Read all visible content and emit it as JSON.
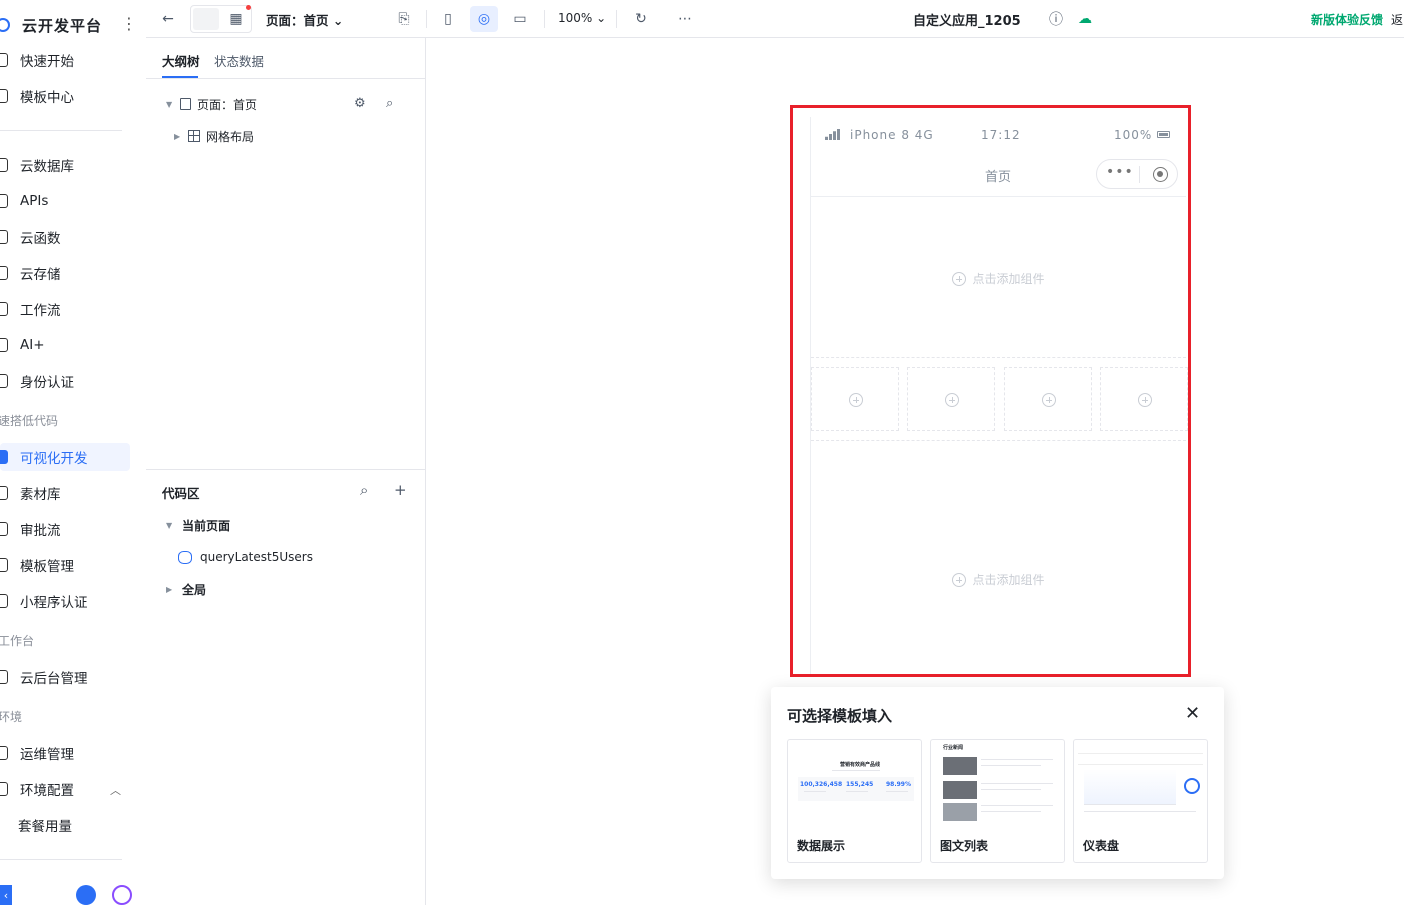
{
  "brand": {
    "title": "云开发平台"
  },
  "sidebar": {
    "items": [
      {
        "label": "快速开始"
      },
      {
        "label": "模板中心"
      },
      {
        "label": "云数据库"
      },
      {
        "label": "APIs"
      },
      {
        "label": "云函数"
      },
      {
        "label": "云存储"
      },
      {
        "label": "工作流"
      },
      {
        "label": "AI+"
      },
      {
        "label": "身份认证"
      },
      {
        "label": "可视化开发"
      },
      {
        "label": "素材库"
      },
      {
        "label": "审批流"
      },
      {
        "label": "模板管理"
      },
      {
        "label": "小程序认证"
      },
      {
        "label": "云后台管理"
      },
      {
        "label": "运维管理"
      },
      {
        "label": "环境配置"
      },
      {
        "label": "套餐用量"
      }
    ],
    "sections": [
      "速搭低代码",
      "工作台",
      "环境"
    ],
    "active_item": "可视化开发"
  },
  "toolbar": {
    "page_label": "页面：首页",
    "zoom": "100%",
    "app_name": "自定义应用_1205",
    "feedback": "新版体验反馈",
    "back": "返"
  },
  "outline": {
    "tabs": [
      "大纲树",
      "状态数据"
    ],
    "page_node": "页面：首页",
    "grid_node": "网格布局"
  },
  "code": {
    "title": "代码区",
    "current_page": "当前页面",
    "query": "queryLatest5Users",
    "global": "全局"
  },
  "phone": {
    "carrier": "iPhone 8  4G",
    "time": "17:12",
    "battery": "100%",
    "title": "首页",
    "add_hint": "点击添加组件"
  },
  "popup": {
    "title": "可选择模板填入",
    "cards": [
      {
        "label": "数据展示",
        "thumb_title": "营销有效商产品线",
        "nums": [
          "100,326,458",
          "155,245",
          "98.99%"
        ]
      },
      {
        "label": "图文列表",
        "thumb_title": "行业新闻"
      },
      {
        "label": "仪表盘"
      }
    ]
  },
  "colors": {
    "accent": "#2b6ef5",
    "highlight": "#e8202a",
    "feedback": "#00a870"
  }
}
